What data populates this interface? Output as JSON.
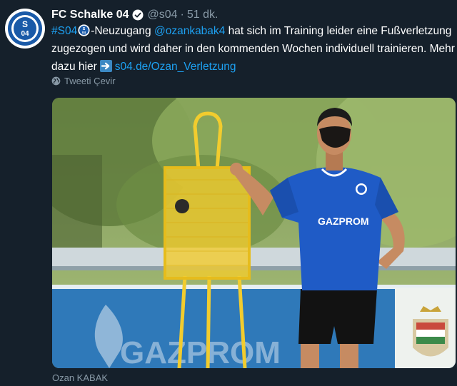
{
  "account": {
    "display_name": "FC Schalke 04",
    "handle": "@s04",
    "separator": "·",
    "time": "51 dk.",
    "avatar_text": "S04"
  },
  "tweet": {
    "hashtag": "#S04",
    "part1": "-Neuzugang ",
    "mention": "@ozankabak4",
    "part2": " hat sich im Training leider eine Fußverletzung zugezogen und wird daher in den kommenden Wochen individuell trainieren. Mehr dazu hier",
    "url": "s04.de/Ozan_Verletzung"
  },
  "actions": {
    "translate_label": "Tweeti Çevir"
  },
  "media": {
    "sponsor_banner": "GAZPROM",
    "jersey_sponsor": "GAZPROM",
    "jersey_crest": "S04"
  },
  "caption": "Ozan KABAK",
  "colors": {
    "background": "#15202b",
    "link": "#1da1f2",
    "secondary_text": "#8899a6",
    "jersey_blue": "#1f5bc6",
    "mannequin_yellow": "#f2cc2e"
  }
}
